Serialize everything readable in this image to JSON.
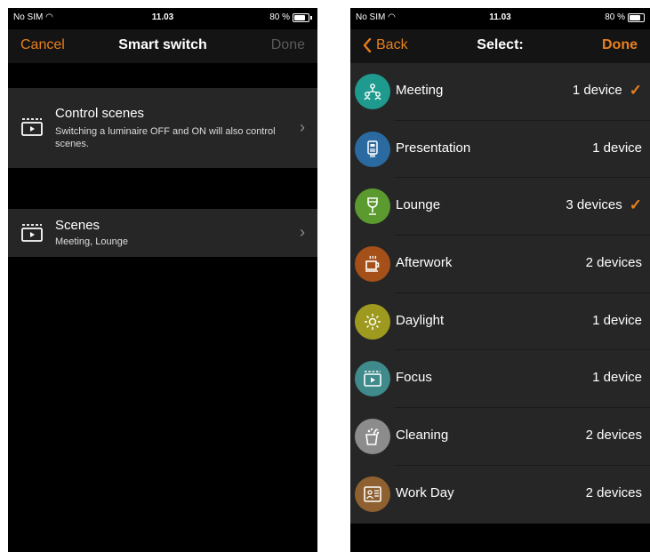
{
  "left": {
    "status": {
      "carrier": "No SIM",
      "time": "11.03",
      "battery": "80 %",
      "battery_level": 0.8
    },
    "nav": {
      "cancel": "Cancel",
      "title": "Smart switch",
      "done": "Done"
    },
    "control_scenes": {
      "title": "Control scenes",
      "subtitle": "Switching a luminaire OFF and ON will also control scenes."
    },
    "scenes": {
      "title": "Scenes",
      "subtitle": "Meeting, Lounge"
    }
  },
  "right": {
    "status": {
      "carrier": "No SIM",
      "time": "11.03",
      "battery": "80 %",
      "battery_level": 0.8
    },
    "nav": {
      "back": "Back",
      "title": "Select:",
      "done": "Done"
    },
    "scenes": [
      {
        "name": "Meeting",
        "devices": "1 device",
        "checked": true,
        "color": "#1f9a8e",
        "icon": "people-network-icon"
      },
      {
        "name": "Presentation",
        "devices": "1 device",
        "checked": false,
        "color": "#2a6aa0",
        "icon": "presentation-icon"
      },
      {
        "name": "Lounge",
        "devices": "3 devices",
        "checked": true,
        "color": "#5b9a2f",
        "icon": "wine-glass-icon"
      },
      {
        "name": "Afterwork",
        "devices": "2 devices",
        "checked": false,
        "color": "#a55018",
        "icon": "coffee-cup-icon"
      },
      {
        "name": "Daylight",
        "devices": "1 device",
        "checked": false,
        "color": "#9e9a1f",
        "icon": "sun-icon"
      },
      {
        "name": "Focus",
        "devices": "1 device",
        "checked": false,
        "color": "#3f8a8a",
        "icon": "clapperboard-icon"
      },
      {
        "name": "Cleaning",
        "devices": "2 devices",
        "checked": false,
        "color": "#8c8c8c",
        "icon": "cleaning-bucket-icon"
      },
      {
        "name": "Work Day",
        "devices": "2 devices",
        "checked": false,
        "color": "#8f6030",
        "icon": "id-card-icon"
      }
    ]
  },
  "colors": {
    "accent": "#e8801c",
    "cell": "#262626",
    "nav": "#141414",
    "background": "#000000"
  }
}
